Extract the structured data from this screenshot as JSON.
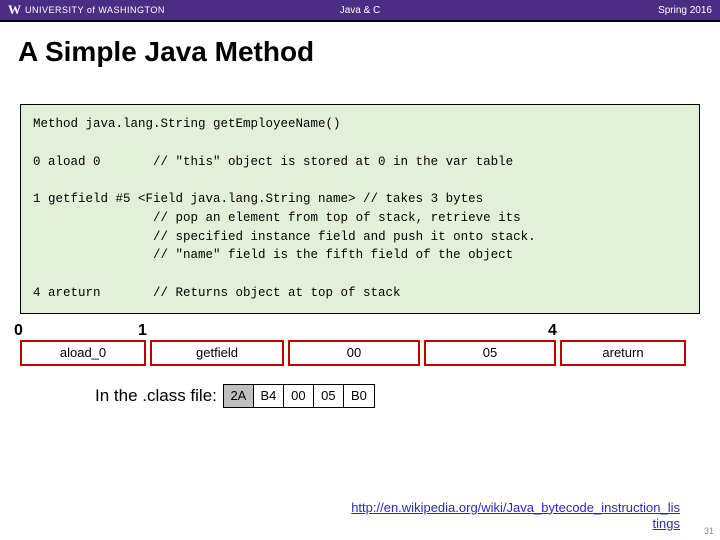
{
  "header": {
    "university_mark": "W",
    "university_text": "UNIVERSITY of WASHINGTON",
    "center": "Java & C",
    "right": "Spring 2016"
  },
  "title": "A Simple Java Method",
  "code": "Method java.lang.String getEmployeeName()\n\n0 aload 0       // \"this\" object is stored at 0 in the var table\n\n1 getfield #5 <Field java.lang.String name> // takes 3 bytes\n                // pop an element from top of stack, retrieve its\n                // specified instance field and push it onto stack.\n                // \"name\" field is the fifth field of the object\n\n4 areturn       // Returns object at top of stack",
  "offsets": {
    "o0": "0",
    "o1": "1",
    "o4": "4"
  },
  "bytes": {
    "b0": "aload_0",
    "b1": "getfield",
    "b2": "00",
    "b3": "05",
    "b4": "areturn"
  },
  "classfile": {
    "label": "In the .class file:",
    "hex": [
      "2A",
      "B4",
      "00",
      "05",
      "B0"
    ]
  },
  "wiki": {
    "line1": "http://en.wikipedia.org/wiki/Java_bytecode_instruction_lis",
    "line2": "tings"
  },
  "page": "31"
}
